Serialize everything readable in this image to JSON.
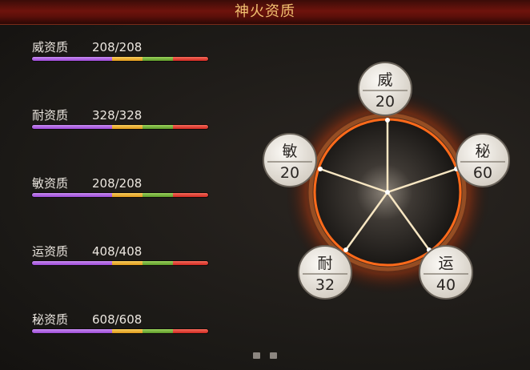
{
  "window": {
    "title": "神火资质"
  },
  "stats": [
    {
      "label": "威资质",
      "value": "208/208"
    },
    {
      "label": "耐资质",
      "value": "328/328"
    },
    {
      "label": "敏资质",
      "value": "208/208"
    },
    {
      "label": "运资质",
      "value": "408/408"
    },
    {
      "label": "秘资质",
      "value": "608/608"
    }
  ],
  "radar": {
    "nodes": [
      {
        "name": "威",
        "value": "20"
      },
      {
        "name": "秘",
        "value": "60"
      },
      {
        "name": "运",
        "value": "40"
      },
      {
        "name": "耐",
        "value": "32"
      },
      {
        "name": "敏",
        "value": "20"
      }
    ]
  },
  "pager": {
    "pages": 2,
    "current": 1
  },
  "colors": {
    "title_text": "#f0c070",
    "title_bar": "#6e130c",
    "ring_glow": "#ff6a1a",
    "spoke": "#f7e6c2",
    "bar_purple": "#9c4ad6",
    "bar_orange": "#e09a1c",
    "bar_green": "#5e9a2a",
    "bar_red": "#cf2a22"
  }
}
